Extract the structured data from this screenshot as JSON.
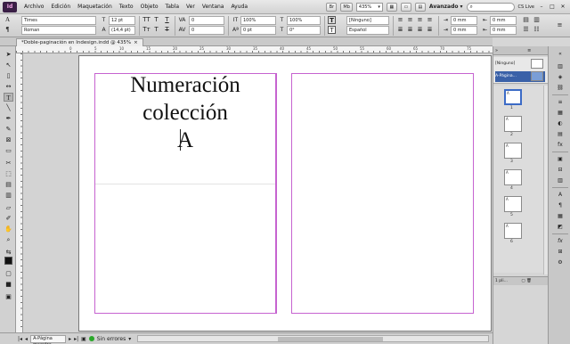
{
  "app": {
    "logo": "Id"
  },
  "menu": [
    "Archivo",
    "Edición",
    "Maquetación",
    "Texto",
    "Objeto",
    "Tabla",
    "Ver",
    "Ventana",
    "Ayuda"
  ],
  "menubar_right": {
    "zoom": "435%",
    "workspace": "Avanzado",
    "cs_live": "CS Live",
    "window_buttons": [
      "–",
      "□",
      "✕"
    ]
  },
  "control": {
    "font_family": "Times",
    "font_style": "Roman",
    "font_size": "12 pt",
    "leading": "(14,4 pt)",
    "kerning": "0",
    "tracking": "0",
    "vscale": "100%",
    "hscale": "100%",
    "baseline": "0 pt",
    "skew": "0°",
    "char_style": "[Ninguno]",
    "language": "Español",
    "indent_values": [
      "0 mm",
      "0 mm",
      "0 mm",
      "0 mm"
    ]
  },
  "document": {
    "tab_title": "*Doble-paginación en Indesign.indd @ 435%",
    "text_lines": [
      "Numeración",
      "colección",
      "A"
    ]
  },
  "ruler_labels": [
    "0",
    "5",
    "10",
    "15",
    "20",
    "25",
    "30",
    "35",
    "40",
    "45",
    "50",
    "55",
    "60",
    "65",
    "70",
    "75"
  ],
  "status": {
    "page_field": "A-Página maestra",
    "preflight": "Sin errores"
  },
  "pages_panel": {
    "masters": [
      "[Ninguno]",
      "A-Página..."
    ],
    "pages": [
      {
        "num": "1",
        "label": "A"
      },
      {
        "num": "2",
        "label": "A"
      },
      {
        "num": "3",
        "label": "A"
      },
      {
        "num": "4",
        "label": "A"
      },
      {
        "num": "5",
        "label": "A"
      },
      {
        "num": "6",
        "label": "A"
      }
    ],
    "footer": "1 pli..."
  }
}
